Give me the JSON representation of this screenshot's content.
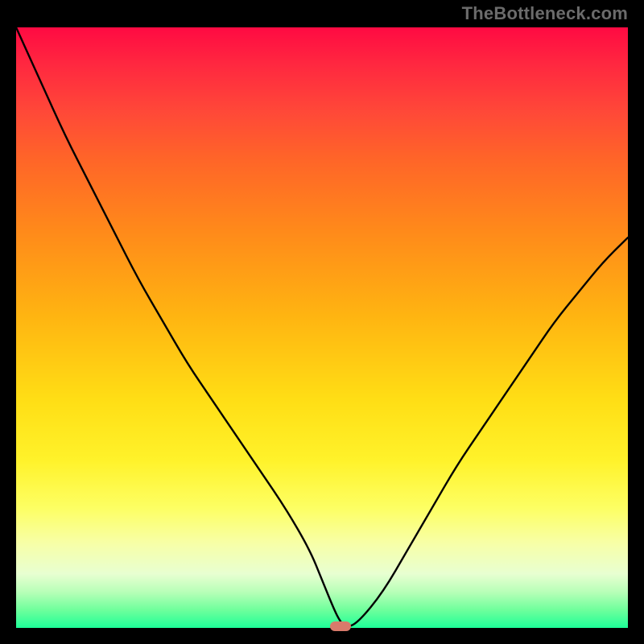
{
  "watermark": "TheBottleneck.com",
  "chart_data": {
    "type": "line",
    "title": "",
    "xlabel": "",
    "ylabel": "",
    "xlim": [
      0,
      100
    ],
    "ylim": [
      0,
      100
    ],
    "grid": false,
    "series": [
      {
        "name": "bottleneck-curve",
        "x": [
          0,
          4,
          8,
          12,
          16,
          20,
          24,
          28,
          32,
          36,
          40,
          44,
          48,
          50,
          52,
          53,
          54,
          56,
          60,
          64,
          68,
          72,
          76,
          80,
          84,
          88,
          92,
          96,
          100
        ],
        "values": [
          100,
          91,
          82,
          74,
          66,
          58,
          51,
          44,
          38,
          32,
          26,
          20,
          13,
          8,
          3,
          1,
          0,
          1,
          6,
          13,
          20,
          27,
          33,
          39,
          45,
          51,
          56,
          61,
          65
        ]
      }
    ],
    "marker": {
      "x": 53,
      "y": 0
    },
    "gradient": {
      "top": "#ff0a42",
      "bottom": "#1dff98"
    }
  }
}
